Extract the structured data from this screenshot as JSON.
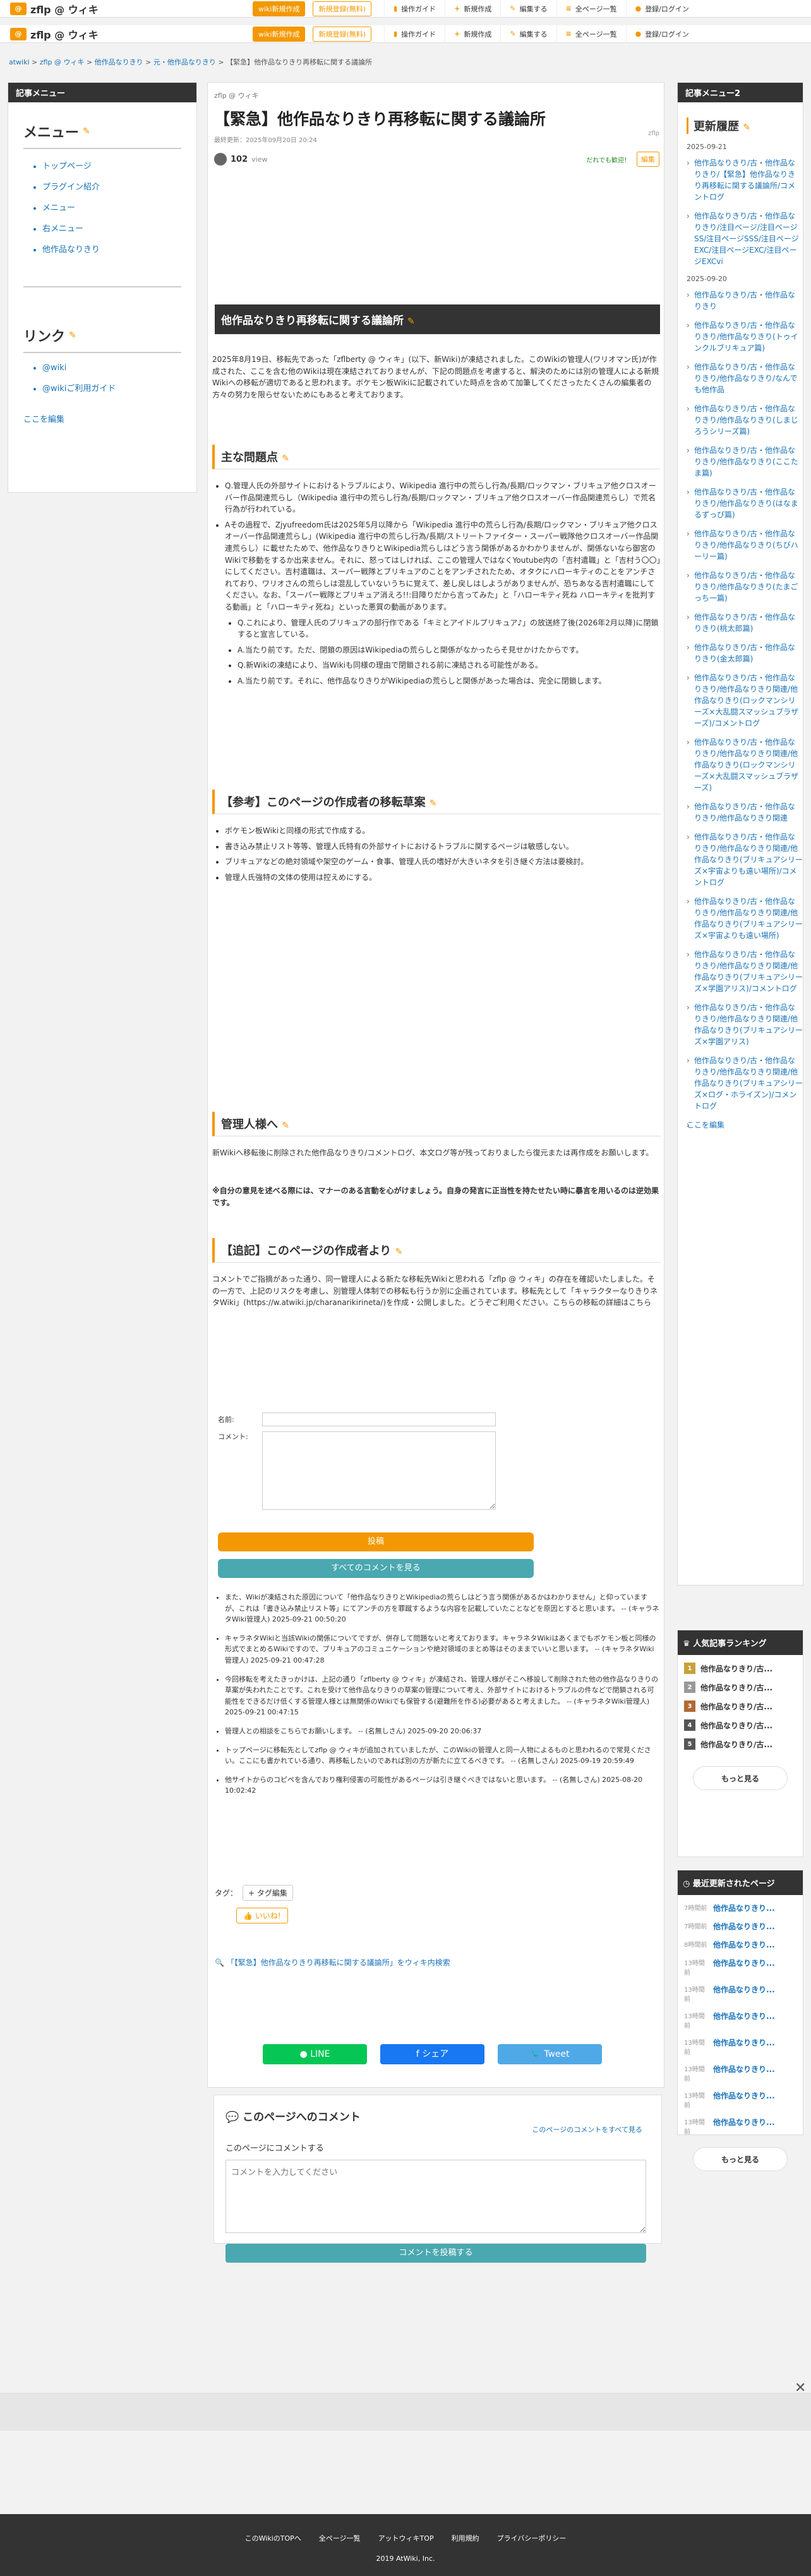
{
  "header": {
    "site_name": "zflp @ ウィキ",
    "btn_create": "wiki新規作成",
    "btn_contact": "新規登録(無料)",
    "nav": [
      "操作ガイド",
      "新規作成",
      "編集する",
      "全ページ一覧",
      "登録/ログイン"
    ]
  },
  "breadcrumb": [
    "atwiki",
    "zflp @ ウィキ",
    "他作品なりきり",
    "元・他作品なりきり",
    "【緊急】他作品なりきり再移転に関する議論所"
  ],
  "left": {
    "header": "記事メニュー",
    "menu_title": "メニュー",
    "menu_items": [
      "トップページ",
      "プラグイン紹介",
      "メニュー",
      "右メニュー",
      "他作品なりきり"
    ],
    "link_title": "リンク",
    "link_items": [
      "@wiki",
      "@wikiご利用ガイド"
    ],
    "edit": "ここを編集"
  },
  "article": {
    "site": "zflp @ ウィキ",
    "title": "【緊急】他作品なりきり再移転に関する議論所",
    "meta": "最終更新：2025年09月20日 20:24",
    "views_count": "102",
    "views_label": "view",
    "good": "だれでも歓迎！",
    "edit": "編集",
    "zflp": "zflp",
    "h2": "他作品なりきり再移転に関する議論所",
    "intro": "2025年8月19日、移転先であった「zflberty @ ウィキ」(以下、新Wiki)が凍結されました。このWikiの管理人(ワリオマン氏)が作成された、ここを含む他のWikiは現在凍結されておりませんが、下記の問題点を考慮すると、解決のためには別の管理人による新規Wikiへの移転が適切であると思われます。ボケモン板Wikiに記載されていた時点を含めて加筆してくださったたくさんの編集者の方々の努力を限らせないためにもあると考えております。",
    "s1": "主な問題点",
    "issues": [
      "Q.管理人氏の外部サイトにおけるトラブルにより、Wikipedia 進行中の荒らし行為/長期/ロックマン・ブリキュア他クロスオーバー作品関連荒らし（Wikipedia 進行中の荒らし行為/長期/ロックマン・ブリキュア他クロスオーバー作品関連荒らし）で荒名行為が行われている。",
      "Aその過程で、Zjyufreedom氏は2025年5月以降から「Wikipedia 進行中の荒らし行為/長期/ロックマン・ブリキュア他クロスオーバー作品関連荒らし」(Wikipedia 進行中の荒らし行為/長期/ストリートファイター・スーパー戦隊他クロスオーバー作品関連荒らし）に載せたためで、他作品なりきりとWikipedia荒らしはどう言う関係があるかわかりませんが、関係ないなら御宮のWikiで移動をするか出来ません。それに、怒ってはしければ、ここの管理人ではなくYoutube内の「吉村遣職」と「吉村う〇〇」にしてください。吉村遣職は、スーパー戦隊とブリキュアのことをアンチされたため、オタクにハローキティのことをアンチされており、ワリオさんの荒らしは混乱していないうちに覚えて、差し戻しはしようがありませんが、恐ちあなる吉村遣職にしてください。なお、「スーパー戦隊とプリキュア消えろ!!:目障りだから言ってみた」と「ハローキティ死ね ハローキティを批判する動画」と「ハローキティ死ね」といった悪質の動画があります。"
    ],
    "qa": [
      "Q.これにより、管理人氏のブリキュアの部行作である「キミとアイドルプリキュア♪」の放送終了後(2026年2月以降)に閉鎖すると宣言している。",
      "A.当たり前です。ただ、閉鎖の原因はWikipediaの荒らしと関係がなかったらそ見せかけたからです。",
      "Q.新Wikiの凍結により、当Wikiも同様の理由で閉鎖される前に凍結される可能性がある。",
      "A.当たり前です。それに、他作品なりきりがWikipediaの荒らしと関係があった場合は、完全に閉鎖します。"
    ],
    "s2": "【参考】このページの作成者の移転草案",
    "drafts": [
      "ボケモン板Wikiと同様の形式で作成する。",
      "書き込み禁止リスト等等、管理人氏特有の外部サイトにおけるトラブルに関するページは敏感しない。",
      "ブリキュアなどの絶対領域や架空のゲーム・食事、管理人氏の嗜好が大きいネタを引き継ぐ方法は要検討。",
      "管理人氏強特の文体の使用は控えめにする。"
    ],
    "s3": "管理人様へ",
    "admin_text": "新Wikiへ移転後に削除された他作品なりきり/コメントログ、本文ログ等が残っておりましたら復元または再作成をお願いします。",
    "admin_note": "※自分の意見を述べる際には、マナーのある言動を心がけましょう。自身の発言に正当性を持たせたい時に暴言を用いるのは逆効果です。",
    "s4": "【追記】このページの作成者より",
    "postscript": "コメントでご指摘があった通り、同一管理人による新たな移転先Wikiと思われる「zflp @ ウィキ」の存在を確認いたしました。その一方で、上記のリスクを考慮し、別管理人体制での移転も行うか別に企画されています。移転先として「キャラクターなりきりネタWiki」(https://w.atwiki.jp/charanarikirineta/)を作成・公開しました。どうぞご利用ください。こちらの移転の詳細はこちら",
    "form_name": "名前:",
    "form_comment": "コメント:",
    "submit": "投稿",
    "all_comments": "すべてのコメントを見る",
    "comments": [
      "また、Wikiが凍結された原因について「他作品なりきりとWikipediaの荒らしはどう言う関係があるかはわかりません」と仰っていますが、これは「書き込み禁止リスト等」にてアンチの方を罪蹴するような内容を記載していたことなどを原因とすると思います。 -- (キャラネタWiki管理人) 2025-09-21 00:50:20",
      "キャラネタWikiと当該Wikiの関係についてですが、併存して問題ないと考えております。キャラネタWikiはあくまでもボケモン板と同様の形式でまとめるWikiですので、ブリキュアのコミュニケーションや絶対領域のまとめ等はそのままでいいと思います。 -- (キャラネタWiki管理人) 2025-09-21 00:47:28",
      "今回移転を考えたきっかけは、上記の通り「zflberty @ ウィキ」が凍結され、管理人様がそこへ移設して削除された他の他作品なりきりの草案が失われたことです。これを受けて他作品なりきりの草案の管理について考え、外部サイトにおけるトラブルの件などで閉鎖される可能性をできるだけ低くする管理人様とは無関係のWikiでも保管する(避難所を作る)必要があると考えました。 -- (キャラネタWiki管理人) 2025-09-21 00:47:15",
      "管理人との相談をこちらでお願いします。 -- (名無しさん) 2025-09-20 20:06:37",
      "トップページに移転先としてzflp @ ウィキが追加されていましたが、このWikiの管理人と同一人物によるものと思われるので常見ください。ここにも書かれている通り、再移転したいのであれば別の方が新たに立てるべきです。 -- (名無しさん) 2025-09-19 20:59:49",
      "他サイトからのコピペを含んでおり権利侵害の可能性があるページは引き継ぐべきではないと思います。 -- (名無しさん) 2025-08-20 10:02:42"
    ],
    "tag_label": "タグ：",
    "tag_edit": "+ タグ編集",
    "like": "いいね!",
    "search_link": "「【緊急】他作品なりきり再移転に関する議論所」をウィキ内検索",
    "share": [
      "LINE",
      "シェア",
      "Tweet"
    ],
    "comment_box_title": "このページへのコメント",
    "comment_box_all": "このページのコメントをすべて見る",
    "comment_box_label": "このページにコメントする",
    "comment_box_placeholder": "コメントを入力してください",
    "comment_box_submit": "コメントを投稿する"
  },
  "right": {
    "header": "記事メニュー2",
    "title": "更新履歴",
    "groups": [
      {
        "date": "2025-09-21",
        "items": [
          "他作品なりきり/古・他作品なりきり/【緊急】他作品なりきり再移転に関する議論所/コメントログ",
          "他作品なりきり/古・他作品なりきり/注目ページ/注目ページSS/注目ページSSS/注目ページEXC/注目ページEXC/注目ページEXCvi"
        ]
      },
      {
        "date": "2025-09-20",
        "items": [
          "他作品なりきり/古・他作品なりきり",
          "他作品なりきり/古・他作品なりきり/他作品なりきり(トゥインクルブリキュア篇)",
          "他作品なりきり/古・他作品なりきり/他作品なりきり/なんでも他作品",
          "他作品なりきり/古・他作品なりきり/他作品なりきり(しまじろうシリーズ篇)",
          "他作品なりきり/古・他作品なりきり/他作品なりきり(ここたま篇)",
          "他作品なりきり/古・他作品なりきり/他作品なりきり(はなまるずっぴ篇)",
          "他作品なりきり/古・他作品なりきり/他作品なりきり(ちびハーリー篇)",
          "他作品なりきり/古・他作品なりきり/他作品なりきり(たまごっち一篇)",
          "他作品なりきり/古・他作品なりきり(桃太郎篇)",
          "他作品なりきり/古・他作品なりきり(金太郎篇)",
          "他作品なりきり/古・他作品なりきり/他作品なりきり関連/他作品なりきり(ロックマンシリーズ×大乱闘スマッシュブラザーズ)/コメントログ",
          "他作品なりきり/古・他作品なりきり/他作品なりきり関連/他作品なりきり(ロックマンシリーズ×大乱闘スマッシュブラザーズ)",
          "他作品なりきり/古・他作品なりきり/他作品なりきり関連",
          "他作品なりきり/古・他作品なりきり/他作品なりきり関連/他作品なりきり(ブリキュアシリーズ×宇宙よりも遠い場所)/コメントログ",
          "他作品なりきり/古・他作品なりきり/他作品なりきり関連/他作品なりきり(ブリキュアシリーズ×宇宙よりも遠い場所)",
          "他作品なりきり/古・他作品なりきり/他作品なりきり関連/他作品なりきり(ブリキュアシリーズ×学園アリス)/コメントログ",
          "他作品なりきり/古・他作品なりきり/他作品なりきり関連/他作品なりきり(ブリキュアシリーズ×学園アリス)",
          "他作品なりきり/古・他作品なりきり/他作品なりきり関連/他作品なりきり(ブリキュアシリーズ×ログ・ホライズン)/コメントログ"
        ]
      }
    ],
    "edit": "ここを編集"
  },
  "ranking": {
    "title": "人気記事ランキング",
    "items": [
      "他作品なりきり/古...",
      "他作品なりきり/古...",
      "他作品なりきり/古...",
      "他作品なりきり/古...",
      "他作品なりきり/古..."
    ],
    "more": "もっと見る"
  },
  "recent": {
    "title": "最近更新されたページ",
    "items": [
      {
        "d": "7時間前",
        "t": "他作品なりきり..."
      },
      {
        "d": "7時間前",
        "t": "他作品なりきり..."
      },
      {
        "d": "8時間前",
        "t": "他作品なりきり..."
      },
      {
        "d": "13時間前",
        "t": "他作品なりきり..."
      },
      {
        "d": "13時間前",
        "t": "他作品なりきり..."
      },
      {
        "d": "13時間前",
        "t": "他作品なりきり..."
      },
      {
        "d": "13時間前",
        "t": "他作品なりきり..."
      },
      {
        "d": "13時間前",
        "t": "他作品なりきり..."
      },
      {
        "d": "13時間前",
        "t": "他作品なりきり..."
      },
      {
        "d": "13時間前",
        "t": "他作品なりきり..."
      }
    ],
    "more": "もっと見る"
  },
  "footer": {
    "links": [
      "このWikiのTOPへ",
      "全ページ一覧",
      "アットウィキTOP",
      "利用規約",
      "プライバシーポリシー"
    ],
    "copy": "2019 AtWiki, Inc."
  }
}
